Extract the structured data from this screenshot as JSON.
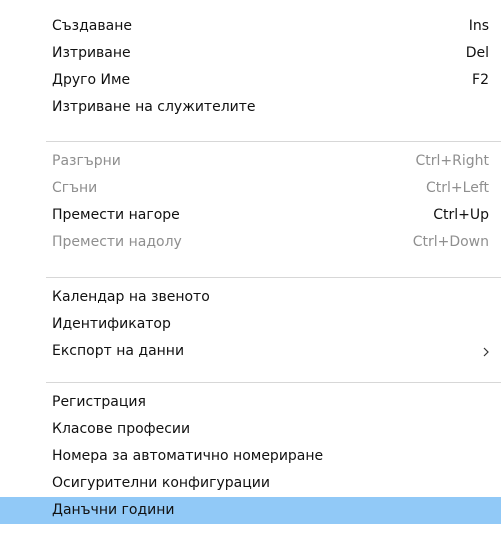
{
  "menu": {
    "groups": [
      {
        "items": [
          {
            "label": "Създаване",
            "shortcut": "Ins"
          },
          {
            "label": "Изтриване",
            "shortcut": "Del"
          },
          {
            "label": "Друго Име",
            "shortcut": "F2"
          },
          {
            "label": "Изтриване на служителите",
            "shortcut": ""
          }
        ]
      },
      {
        "items": [
          {
            "label": "Разгърни",
            "shortcut": "Ctrl+Right",
            "disabled": true
          },
          {
            "label": "Сгъни",
            "shortcut": "Ctrl+Left",
            "disabled": true
          },
          {
            "label": "Премести нагоре",
            "shortcut": "Ctrl+Up",
            "disabled": false
          },
          {
            "label": "Премести надолу",
            "shortcut": "Ctrl+Down",
            "disabled": true
          }
        ]
      },
      {
        "items": [
          {
            "label": "Календар на звеното",
            "shortcut": ""
          },
          {
            "label": "Идентификатор",
            "shortcut": ""
          },
          {
            "label": "Експорт на данни",
            "shortcut": "",
            "submenu": true
          }
        ]
      },
      {
        "items": [
          {
            "label": "Регистрация",
            "shortcut": ""
          },
          {
            "label": "Класове професии",
            "shortcut": ""
          },
          {
            "label": "Номера за автоматично номериране",
            "shortcut": ""
          },
          {
            "label": "Осигурителни конфигурации",
            "shortcut": ""
          },
          {
            "label": "Данъчни години",
            "shortcut": "",
            "selected": true
          }
        ]
      }
    ],
    "colors": {
      "selected_background": "#91c9f7",
      "disabled_text": "#8f8f8f",
      "separator": "#d7d7d7"
    },
    "icons": {
      "submenu": "chevron-right-icon"
    }
  }
}
